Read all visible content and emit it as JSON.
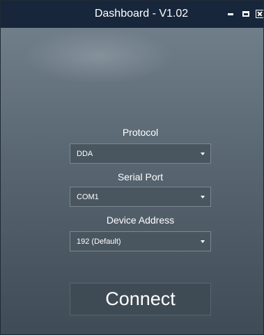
{
  "window": {
    "title": "Dashboard - V1.02"
  },
  "form": {
    "protocol": {
      "label": "Protocol",
      "value": "DDA"
    },
    "serial_port": {
      "label": "Serial Port",
      "value": "COM1"
    },
    "device_address": {
      "label": "Device Address",
      "value": "192 (Default)"
    }
  },
  "actions": {
    "connect_label": "Connect"
  },
  "icons": {
    "minimize": "minimize-icon",
    "maximize": "maximize-icon",
    "close": "close-icon",
    "dropdown": "chevron-down-icon"
  },
  "colors": {
    "titlebar": "#17263a",
    "background_top": "#74838f",
    "background_bottom": "#3f4b55",
    "input_background": "#4a565f",
    "text": "#ffffff"
  }
}
